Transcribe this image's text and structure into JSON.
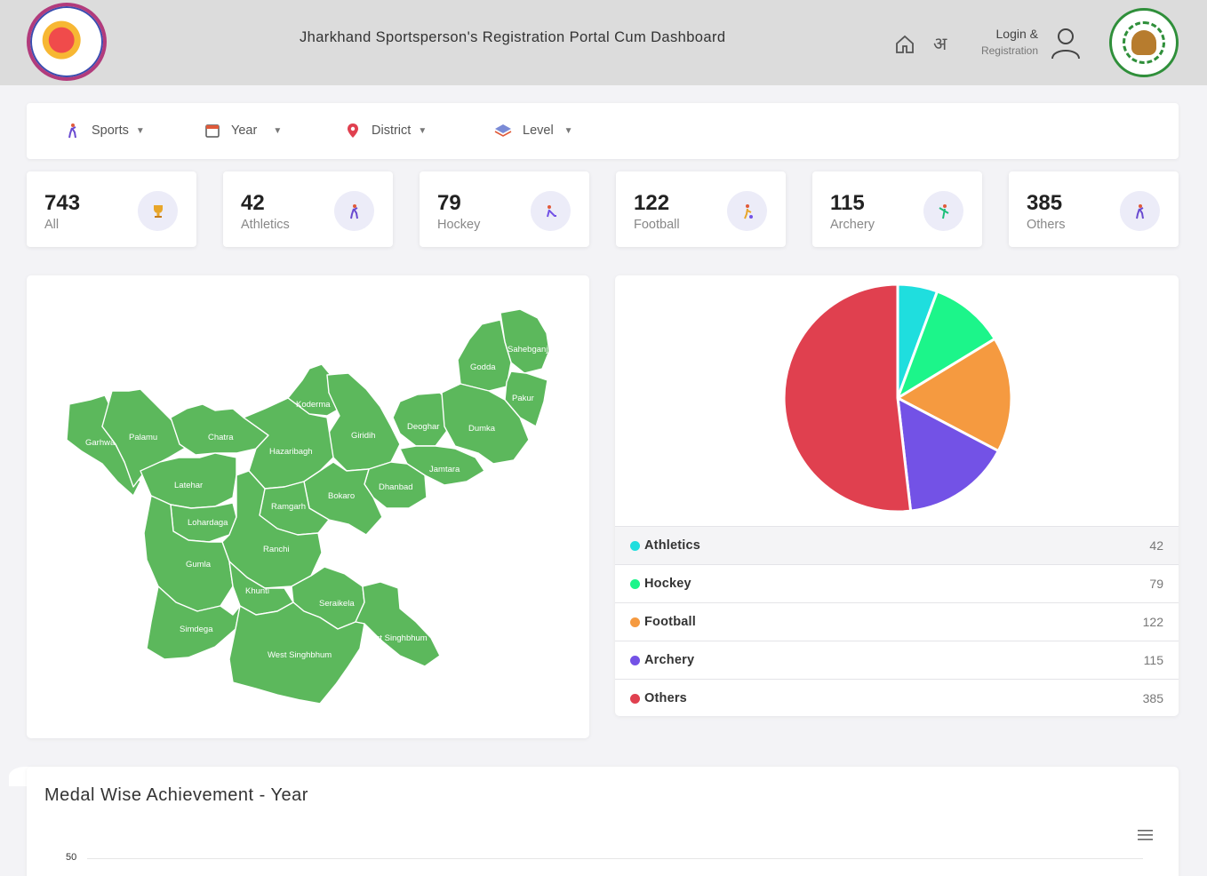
{
  "header": {
    "title": "Jharkhand Sportsperson's Registration Portal Cum Dashboard",
    "lang_glyph": "अ",
    "login_label": "Login &",
    "registration_label": "Registration"
  },
  "filters": [
    {
      "label": "Sports",
      "icon": "athlete-icon"
    },
    {
      "label": "Year",
      "icon": "calendar-icon"
    },
    {
      "label": "District",
      "icon": "location-pin-icon"
    },
    {
      "label": "Level",
      "icon": "layers-icon"
    }
  ],
  "stats": [
    {
      "value": "743",
      "label": "All",
      "icon": "trophy-icon"
    },
    {
      "value": "42",
      "label": "Athletics",
      "icon": "athletics-icon"
    },
    {
      "value": "79",
      "label": "Hockey",
      "icon": "hockey-icon"
    },
    {
      "value": "122",
      "label": "Football",
      "icon": "football-icon"
    },
    {
      "value": "115",
      "label": "Archery",
      "icon": "archery-icon"
    },
    {
      "value": "385",
      "label": "Others",
      "icon": "others-icon"
    }
  ],
  "map": {
    "fill_color": "#5cb85c",
    "districts": [
      "Sahebganj",
      "Godda",
      "Pakur",
      "Koderma",
      "Garhwa",
      "Palamu",
      "Chatra",
      "Giridih",
      "Deoghar",
      "Dumka",
      "Hazaribagh",
      "Jamtara",
      "Latehar",
      "Dhanbad",
      "Bokaro",
      "Ramgarh",
      "Lohardaga",
      "Ranchi",
      "Gumla",
      "Khunti",
      "Seraikela",
      "East Singhbhum",
      "Simdega",
      "West Singhbhum"
    ]
  },
  "chart_data": {
    "type": "pie",
    "categories": [
      "Athletics",
      "Hockey",
      "Football",
      "Archery",
      "Others"
    ],
    "values": [
      42,
      79,
      122,
      115,
      385
    ],
    "colors": [
      "#1fdede",
      "#1cf58a",
      "#f59a40",
      "#7352e6",
      "#e0404f"
    ],
    "legend": "bottom"
  },
  "legend": [
    {
      "name": "Athletics",
      "value": "42",
      "color": "#1fdede"
    },
    {
      "name": "Hockey",
      "value": "79",
      "color": "#1cf58a"
    },
    {
      "name": "Football",
      "value": "122",
      "color": "#f59a40"
    },
    {
      "name": "Archery",
      "value": "115",
      "color": "#7352e6"
    },
    {
      "name": "Others",
      "value": "385",
      "color": "#e0404f"
    }
  ],
  "medal": {
    "title": "Medal Wise Achievement - Year",
    "y_tick": "50"
  }
}
